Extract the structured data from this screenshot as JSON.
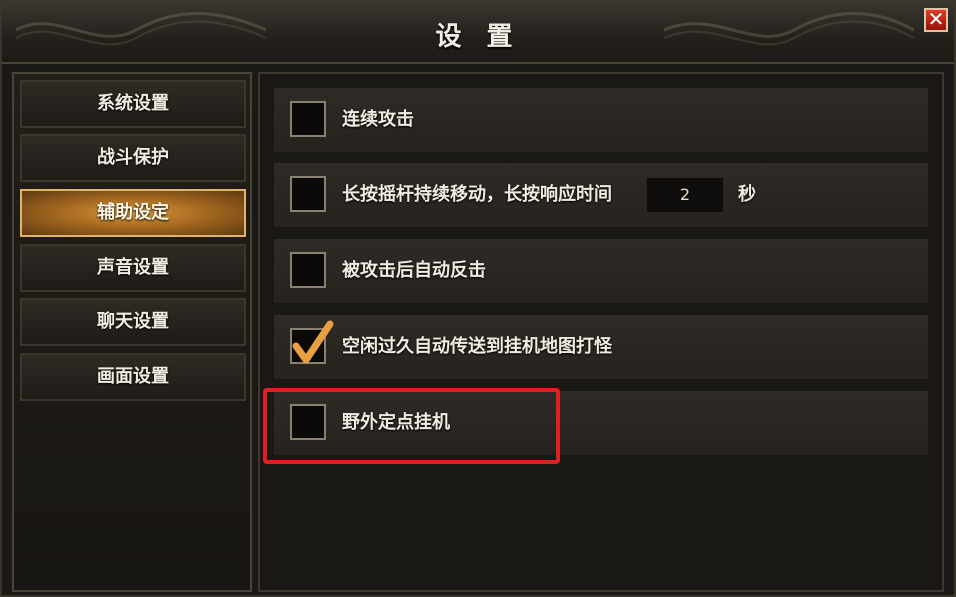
{
  "window": {
    "title": "设 置"
  },
  "sidebar": {
    "items": [
      {
        "label": "系统设置",
        "active": false
      },
      {
        "label": "战斗保护",
        "active": false
      },
      {
        "label": "辅助设定",
        "active": true
      },
      {
        "label": "声音设置",
        "active": false
      },
      {
        "label": "聊天设置",
        "active": false
      },
      {
        "label": "画面设置",
        "active": false
      }
    ]
  },
  "options": [
    {
      "label": "连续攻击",
      "checked": false
    },
    {
      "label": "长按摇杆持续移动，长按响应时间",
      "checked": false,
      "input_value": "2",
      "unit": "秒"
    },
    {
      "label": "被攻击后自动反击",
      "checked": false
    },
    {
      "label": "空闲过久自动传送到挂机地图打怪",
      "checked": true
    },
    {
      "label": "野外定点挂机",
      "checked": false,
      "highlighted": true
    }
  ],
  "colors": {
    "accent": "#d99a3c",
    "highlight": "#e02020",
    "check": "#e8a040"
  },
  "icons": {
    "close": "close-icon",
    "check": "checkmark-icon"
  }
}
